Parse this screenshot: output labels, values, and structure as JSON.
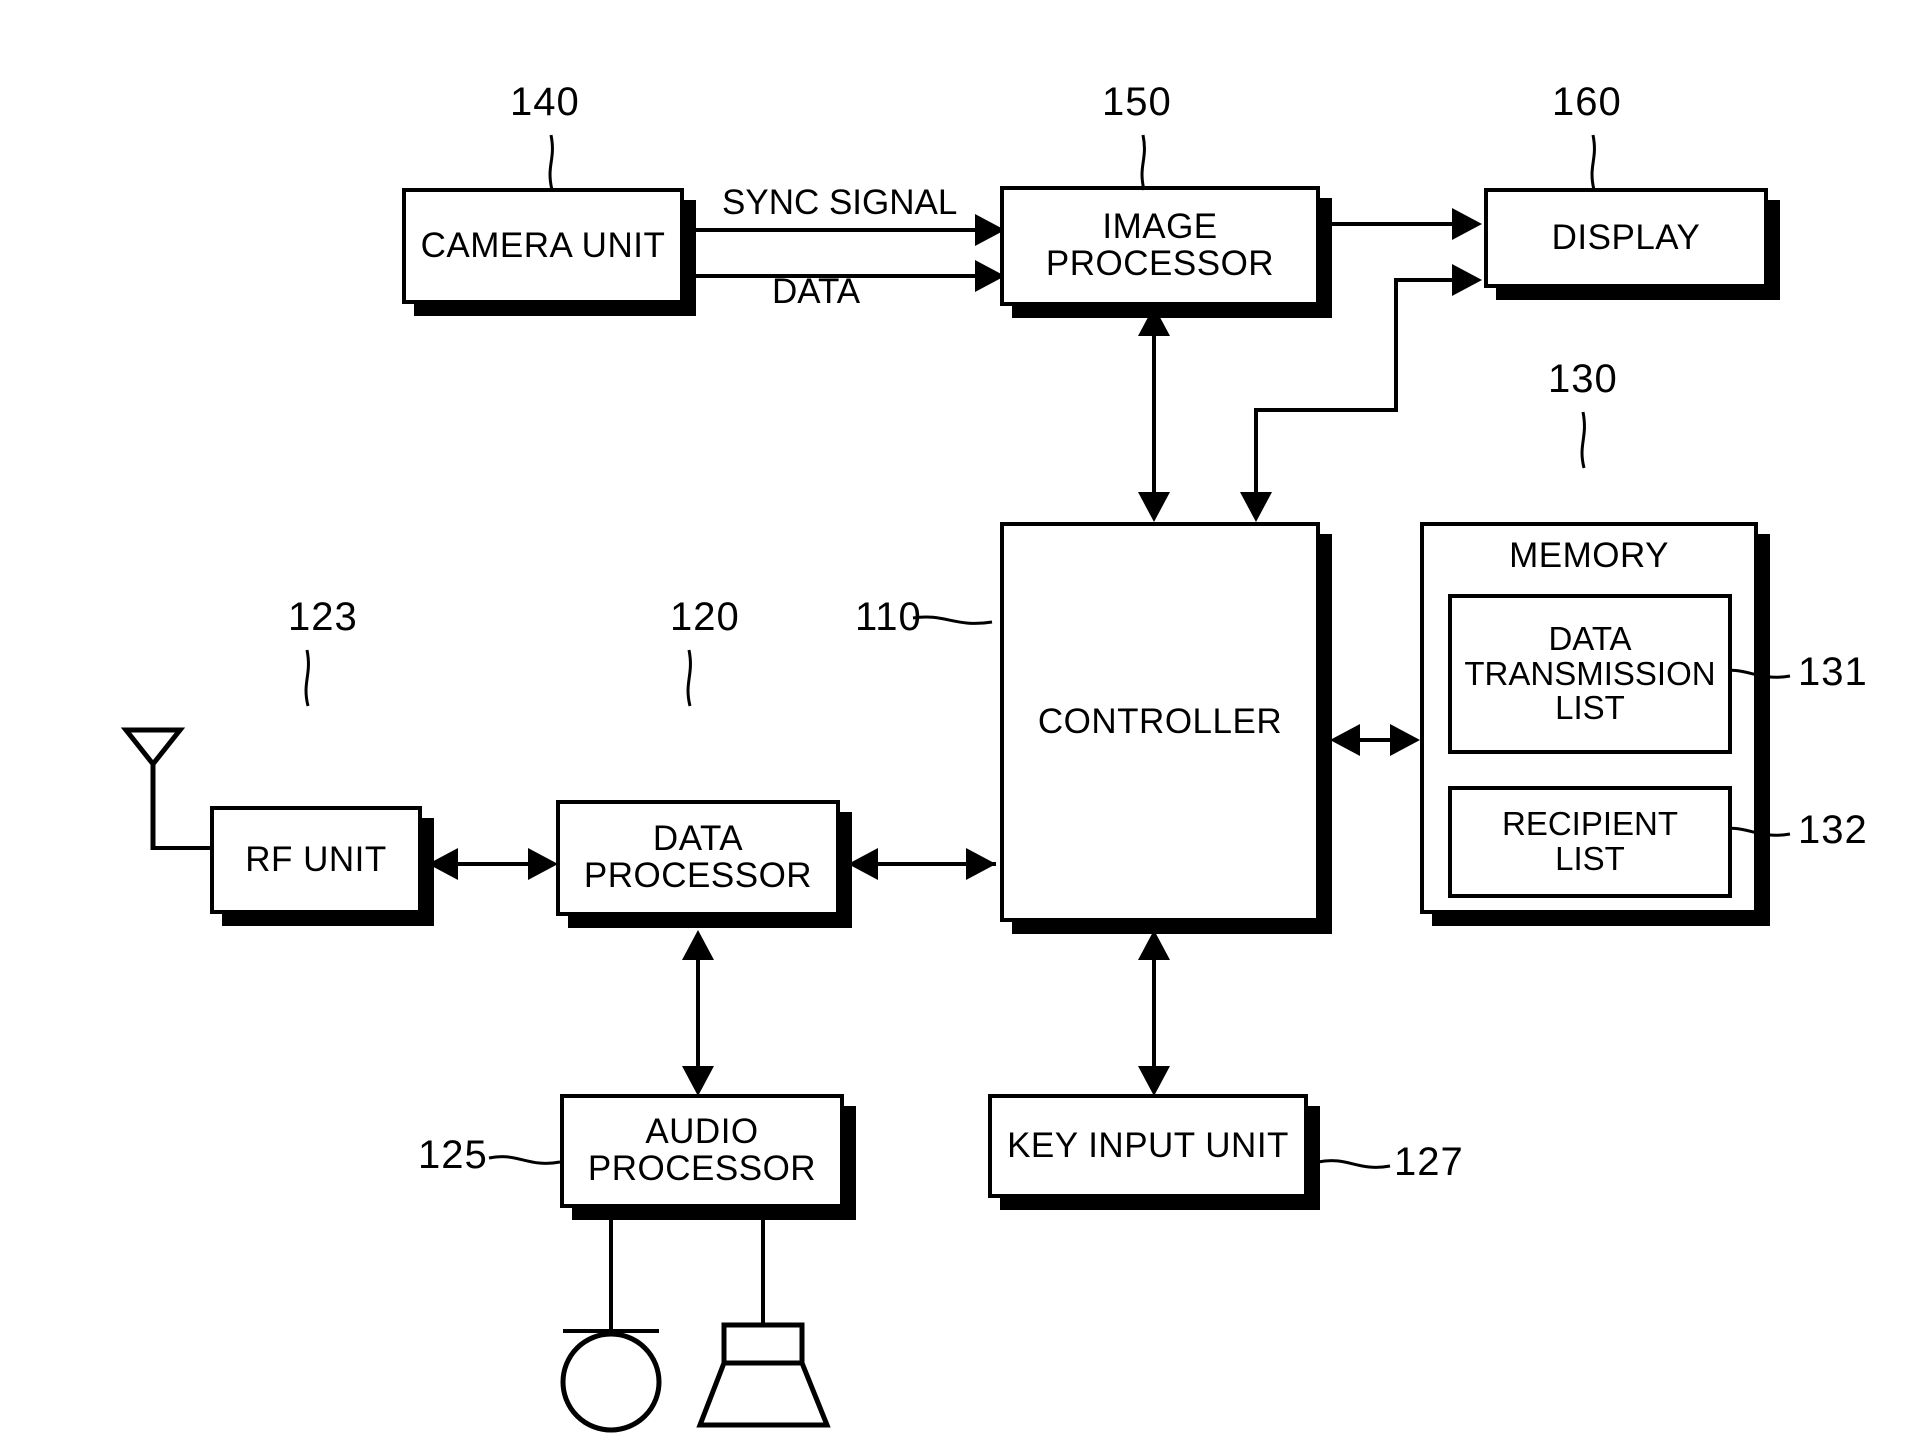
{
  "figure": {
    "type": "patent-block-diagram",
    "blocks": [
      {
        "id": "camera_unit",
        "label": "CAMERA UNIT",
        "ref": "140"
      },
      {
        "id": "image_processor",
        "label": "IMAGE\nPROCESSOR",
        "ref": "150"
      },
      {
        "id": "display",
        "label": "DISPLAY",
        "ref": "160"
      },
      {
        "id": "controller",
        "label": "CONTROLLER",
        "ref": "110"
      },
      {
        "id": "memory",
        "label": "MEMORY",
        "ref": "130"
      },
      {
        "id": "data_transmission_list",
        "label": "DATA\nTRANSMISSION\nLIST",
        "ref": "131"
      },
      {
        "id": "recipient_list",
        "label": "RECIPIENT\nLIST",
        "ref": "132"
      },
      {
        "id": "rf_unit",
        "label": "RF UNIT",
        "ref": "123"
      },
      {
        "id": "data_processor",
        "label": "DATA\nPROCESSOR",
        "ref": "120"
      },
      {
        "id": "audio_processor",
        "label": "AUDIO\nPROCESSOR",
        "ref": "125"
      },
      {
        "id": "key_input_unit",
        "label": "KEY INPUT UNIT",
        "ref": "127"
      }
    ],
    "block_text": {
      "camera_unit": "CAMERA UNIT",
      "image_processor_line1": "IMAGE",
      "image_processor_line2": "PROCESSOR",
      "display": "DISPLAY",
      "controller": "CONTROLLER",
      "memory": "MEMORY",
      "data_transmission_list_line1": "DATA",
      "data_transmission_list_line2": "TRANSMISSION",
      "data_transmission_list_line3": "LIST",
      "recipient_list_line1": "RECIPIENT",
      "recipient_list_line2": "LIST",
      "rf_unit": "RF UNIT",
      "data_processor_line1": "DATA",
      "data_processor_line2": "PROCESSOR",
      "audio_processor_line1": "AUDIO",
      "audio_processor_line2": "PROCESSOR",
      "key_input_unit": "KEY INPUT UNIT"
    },
    "refs": {
      "camera_unit": "140",
      "image_processor": "150",
      "display": "160",
      "controller": "110",
      "memory": "130",
      "data_transmission_list": "131",
      "recipient_list": "132",
      "rf_unit": "123",
      "data_processor": "120",
      "audio_processor": "125",
      "key_input_unit": "127"
    },
    "edge_labels": {
      "sync_signal": "SYNC SIGNAL",
      "data": "DATA"
    },
    "icons": {
      "antenna": "antenna-icon",
      "microphone": "microphone-icon",
      "speaker": "speaker-icon"
    },
    "colors": {
      "ink": "#000000",
      "paper": "#ffffff"
    }
  }
}
